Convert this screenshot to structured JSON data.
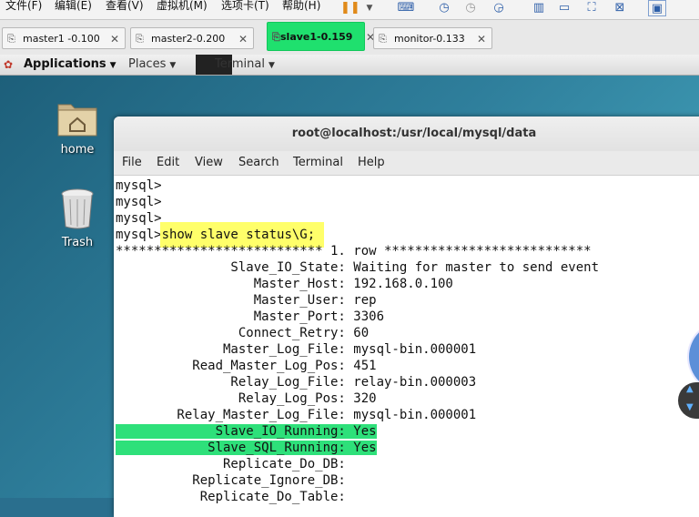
{
  "vm_menu": {
    "items": [
      "文件(F)",
      "编辑(E)",
      "查看(V)",
      "虚拟机(M)",
      "选项卡(T)",
      "帮助(H)"
    ]
  },
  "vm_tabs": [
    {
      "label": "master1 -0.100",
      "active": false
    },
    {
      "label": "master2-0.200",
      "active": false
    },
    {
      "label": "slave1-0.159",
      "active": true
    },
    {
      "label": "monitor-0.133",
      "active": false
    }
  ],
  "gnome_panel": {
    "applications": "Applications",
    "places": "Places",
    "terminal": "Terminal"
  },
  "desktop_icons": [
    {
      "label": "home",
      "icon": "home-folder-icon"
    },
    {
      "label": "Trash",
      "icon": "trash-icon"
    }
  ],
  "terminal": {
    "title": "root@localhost:/usr/local/mysql/data",
    "menu": [
      "File",
      "Edit",
      "View",
      "Search",
      "Terminal",
      "Help"
    ],
    "lines": [
      "mysql>",
      "mysql>",
      "mysql>",
      "mysql> show slave status\\G;",
      "*************************** 1. row ***************************",
      "               Slave_IO_State: Waiting for master to send event",
      "                  Master_Host: 192.168.0.100",
      "                  Master_User: rep",
      "                  Master_Port: 3306",
      "                Connect_Retry: 60",
      "              Master_Log_File: mysql-bin.000001",
      "          Read_Master_Log_Pos: 451",
      "               Relay_Log_File: relay-bin.000003",
      "                Relay_Log_Pos: 320",
      "        Relay_Master_Log_File: mysql-bin.000001",
      "             Slave_IO_Running: Yes",
      "            Slave_SQL_Running: Yes",
      "              Replicate_Do_DB:",
      "          Replicate_Ignore_DB:",
      "           Replicate_Do_Table:"
    ],
    "highlight_command": "show slave status\\G;"
  },
  "colors": {
    "active_tab": "#1fe06e",
    "highlight_yellow": "#ffff6a",
    "highlight_green": "#2ee07a"
  }
}
